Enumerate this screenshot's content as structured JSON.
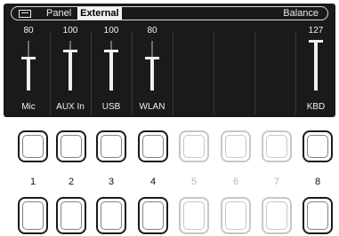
{
  "header": {
    "tabs": [
      {
        "label": "Panel",
        "active": false
      },
      {
        "label": "External",
        "active": true
      }
    ],
    "balance_label": "Balance",
    "icon": "display-icon"
  },
  "channels": [
    {
      "name": "Mic",
      "value": "80",
      "level": 80
    },
    {
      "name": "AUX In",
      "value": "100",
      "level": 100
    },
    {
      "name": "USB",
      "value": "100",
      "level": 100
    },
    {
      "name": "WLAN",
      "value": "80",
      "level": 80
    },
    {
      "name": "",
      "value": "",
      "level": null
    },
    {
      "name": "",
      "value": "",
      "level": null
    },
    {
      "name": "",
      "value": "",
      "level": null
    },
    {
      "name": "KBD",
      "value": "127",
      "level": 127
    }
  ],
  "buttons": [
    {
      "number": "1",
      "enabled": true
    },
    {
      "number": "2",
      "enabled": true
    },
    {
      "number": "3",
      "enabled": true
    },
    {
      "number": "4",
      "enabled": true
    },
    {
      "number": "5",
      "enabled": false
    },
    {
      "number": "6",
      "enabled": false
    },
    {
      "number": "7",
      "enabled": false
    },
    {
      "number": "8",
      "enabled": true
    }
  ],
  "colors": {
    "screen": "#1a1a1a",
    "text": "#f0f0f0",
    "disabled": "#c7c7c7"
  }
}
